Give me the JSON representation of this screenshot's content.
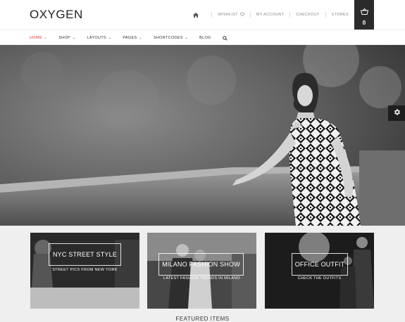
{
  "brand": {
    "logo": "OXYGEN"
  },
  "top_links": {
    "wishlist": "WISHLIST",
    "my_account": "MY ACCOUNT",
    "checkout": "CHECKOUT",
    "stores": "STORES"
  },
  "cart": {
    "count": "0"
  },
  "nav": {
    "items": [
      {
        "label": "HOME",
        "has_caret": true,
        "active": true
      },
      {
        "label": "SHOP",
        "has_caret": true
      },
      {
        "label": "LAYOUTS",
        "has_caret": true
      },
      {
        "label": "PAGES",
        "has_caret": true
      },
      {
        "label": "SHORTCODES",
        "has_caret": true
      },
      {
        "label": "BLOG",
        "has_caret": false
      }
    ]
  },
  "categories": [
    {
      "title": "NYC STREET STYLE",
      "subtitle": "STREET PICS FROM NEW YORK"
    },
    {
      "title": "MILANO FASHION SHOW",
      "subtitle": "LATEST FASHION TRENDS IN MILANO"
    },
    {
      "title": "OFFICE OUTFIT",
      "subtitle": "CHECK THE OUTFITS"
    }
  ],
  "featured": {
    "heading": "FEATURED ITEMS"
  },
  "colors": {
    "accent": "#e23a3a",
    "dark": "#2b2b2b",
    "bg": "#efefef"
  },
  "icons": {
    "home": "home-icon",
    "wishlist": "heart-icon",
    "cart": "basket-icon",
    "search": "search-icon",
    "settings": "gear-icon",
    "caret": "chevron-down-icon"
  }
}
